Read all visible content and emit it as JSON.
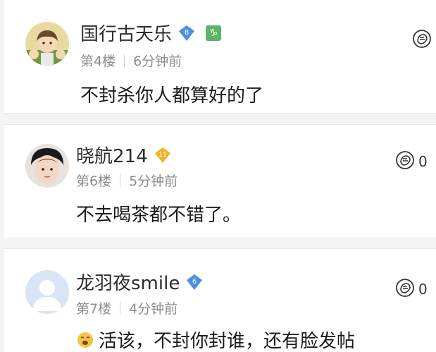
{
  "comments": [
    {
      "username": "国行古天乐",
      "level": "8",
      "floor": "第4楼",
      "time": "6分钟前",
      "text": "不封杀你人都算好的了",
      "likes": ""
    },
    {
      "username": "晓航214",
      "level": "11",
      "floor": "第6楼",
      "time": "5分钟前",
      "text": "不去喝茶都不错了。",
      "likes": "0"
    },
    {
      "username": "龙羽夜smile",
      "level": "6",
      "floor": "第7楼",
      "time": "4分钟前",
      "text": "活该，不封你封谁，还有脸发帖",
      "likes": "0"
    }
  ],
  "colors": {
    "badge_blue": "#4a90e2",
    "badge_gold": "#f0b429",
    "zodiac_green": "#5fb36a"
  }
}
